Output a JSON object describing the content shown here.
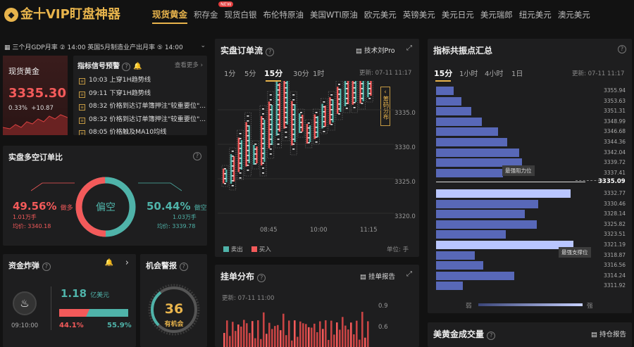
{
  "header": {
    "logo": "金十VIP盯盘神器",
    "nav": [
      "现货黄金",
      "积存金",
      "现货白银",
      "布伦特原油",
      "美国WTI原油",
      "欧元美元",
      "英镑美元",
      "美元日元",
      "美元瑞郎",
      "纽元美元",
      "澳元美元"
    ],
    "new_badge": "NEW"
  },
  "ticker": {
    "text": "三个月GDP月率 ② 14:00 英国5月制造业产出月率 ⑤ 14:00"
  },
  "gold": {
    "title": "现货黄金",
    "price": "3335.30",
    "pct": "0.33%",
    "change": "+10.87"
  },
  "signals": {
    "title": "指标信号预警",
    "more": "查看更多",
    "items": [
      {
        "time": "10:03",
        "text": "上穿1H趋势线"
      },
      {
        "time": "09:11",
        "text": "下穿1H趋势线"
      },
      {
        "time": "08:32",
        "text": "价格到达订单簿押注\"较重要位\"..."
      },
      {
        "time": "08:32",
        "text": "价格到达订单簿押注\"较重要位\"..."
      },
      {
        "time": "08:05",
        "text": "价格触及MA10均线"
      }
    ]
  },
  "longshort": {
    "title": "实盘多空订单比",
    "center": "偏空",
    "long_pct": "49.56%",
    "long_label": "做多",
    "long_lots": "1.01万手",
    "long_avg": "均价: 3340.18",
    "short_pct": "50.44%",
    "short_label": "做空",
    "short_lots": "1.03万手",
    "short_avg": "均价: 3339.78",
    "long_share": 49.56
  },
  "fund": {
    "title": "资金炸弹",
    "time": "09:10:00",
    "amount": "1.18",
    "unit": "亿美元",
    "left_pct": "44.1%",
    "right_pct": "55.9%",
    "left_share": 44.1
  },
  "alarm": {
    "title": "机会警报",
    "value": "36",
    "label": "有机会",
    "level": 36
  },
  "orderflow": {
    "title": "实盘订单流",
    "tool": "技术刘Pro",
    "tabs": [
      "1分",
      "5分",
      "15分",
      "30分",
      "1时"
    ],
    "updated": "更新: 07-11 11:17",
    "side_label": "筹码分布",
    "yticks": [
      "3335.0",
      "3330.0",
      "3325.0",
      "3320.0"
    ],
    "xticks": [
      "08:45",
      "10:00",
      "11:15"
    ],
    "legend_sell": "卖出",
    "legend_buy": "买入",
    "unit": "单位: 手"
  },
  "orders": {
    "title": "挂单分布",
    "report": "挂单报告",
    "updated": "更新: 07-11 11:00",
    "yticks": [
      "0.9",
      "0.6"
    ]
  },
  "pivot": {
    "title": "指标共振点汇总",
    "tabs": [
      "15分",
      "1小时",
      "4小时",
      "1日"
    ],
    "updated": "更新: 07-11 11:17",
    "levels": [
      "3355.94",
      "3353.63",
      "3351.31",
      "3348.99",
      "3346.68",
      "3344.36",
      "3342.04",
      "3339.72",
      "3337.41",
      "3335.09",
      "3332.77",
      "3330.46",
      "3328.14",
      "3325.82",
      "3323.51",
      "3321.19",
      "3318.87",
      "3316.56",
      "3314.24",
      "3311.92"
    ],
    "strengths": [
      0.12,
      0.17,
      0.24,
      0.31,
      0.42,
      0.48,
      0.56,
      0.58,
      0.45,
      0.0,
      0.91,
      0.69,
      0.6,
      0.68,
      0.47,
      0.93,
      0.26,
      0.32,
      0.53,
      0.18
    ],
    "current": "3335.09",
    "resist_label": "最强阻力位",
    "support_label": "最强支撑位",
    "weak": "弱",
    "strong": "强"
  },
  "volume": {
    "title": "美黄金成交量",
    "report": "持仓报告"
  },
  "colors": {
    "accent": "#e8b44c",
    "red": "#f35a5a",
    "green": "#4fb3a9",
    "bar": "#5868b8"
  }
}
